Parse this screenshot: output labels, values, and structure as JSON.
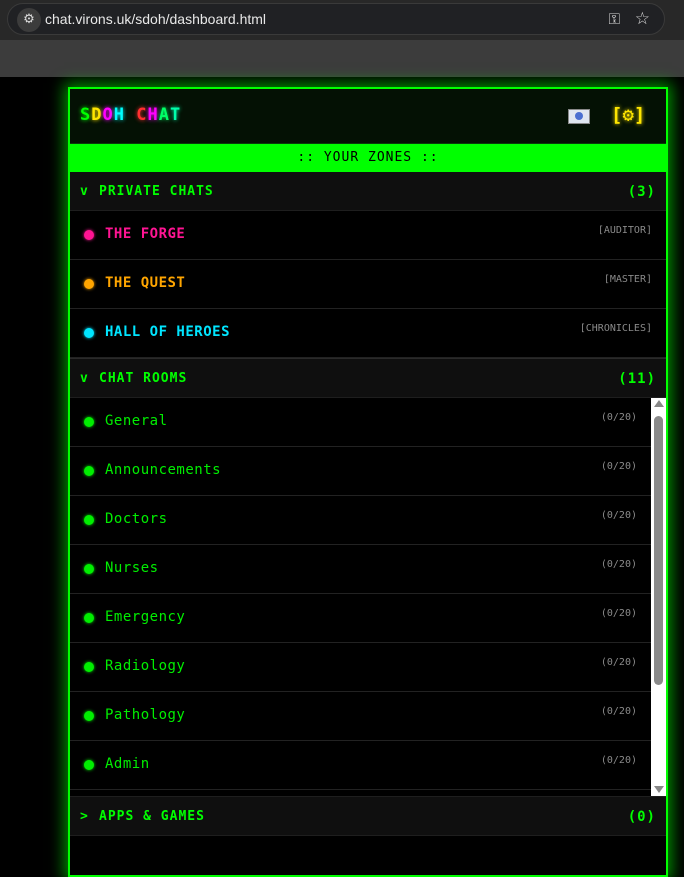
{
  "browser": {
    "url": "chat.virons.uk/sdoh/dashboard.html"
  },
  "brand": {
    "letters": [
      {
        "ch": "S",
        "color": "#00ff00"
      },
      {
        "ch": "D",
        "color": "#ffe600"
      },
      {
        "ch": "O",
        "color": "#ff00ff"
      },
      {
        "ch": "H",
        "color": "#00ffff"
      },
      {
        "ch": " ",
        "color": "#000000"
      },
      {
        "ch": "C",
        "color": "#ff3030"
      },
      {
        "ch": "H",
        "color": "#ff00ff"
      },
      {
        "ch": "A",
        "color": "#00ff66"
      },
      {
        "ch": "T",
        "color": "#00ffaa"
      }
    ]
  },
  "header": {
    "settings_label": "[⚙]"
  },
  "zones_bar": ":: YOUR ZONES ::",
  "private": {
    "chevron": "v",
    "title": "PRIVATE CHATS",
    "count": "(3)",
    "items": [
      {
        "name": "THE FORGE",
        "tag": "[AUDITOR]",
        "color": "#ff1493"
      },
      {
        "name": "THE QUEST",
        "tag": "[MASTER]",
        "color": "#ffa500"
      },
      {
        "name": "HALL OF HEROES",
        "tag": "[CHRONICLES]",
        "color": "#00e5ff"
      }
    ]
  },
  "rooms": {
    "chevron": "v",
    "title": "CHAT ROOMS",
    "count": "(11)",
    "items": [
      {
        "name": "General",
        "tag": "(0/20)"
      },
      {
        "name": "Announcements",
        "tag": "(0/20)"
      },
      {
        "name": "Doctors",
        "tag": "(0/20)"
      },
      {
        "name": "Nurses",
        "tag": "(0/20)"
      },
      {
        "name": "Emergency",
        "tag": "(0/20)"
      },
      {
        "name": "Radiology",
        "tag": "(0/20)"
      },
      {
        "name": "Pathology",
        "tag": "(0/20)"
      },
      {
        "name": "Admin",
        "tag": "(0/20)"
      }
    ]
  },
  "apps": {
    "chevron": ">",
    "title": "APPS & GAMES",
    "count": "(0)"
  }
}
